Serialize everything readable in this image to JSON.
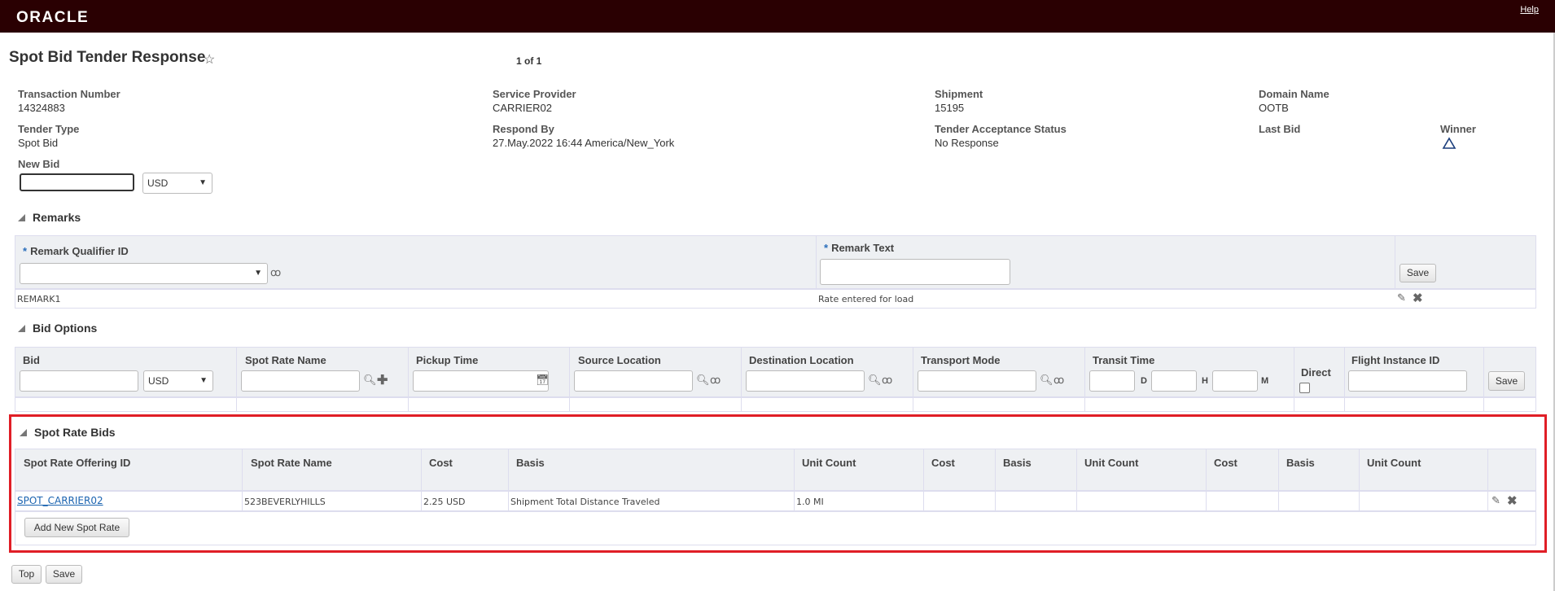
{
  "header": {
    "logo": "ORACLE",
    "help": "Help"
  },
  "page": {
    "title": "Spot Bid Tender Response",
    "pager": "1 of 1"
  },
  "fields": {
    "transaction_number": {
      "label": "Transaction Number",
      "value": "14324883"
    },
    "service_provider": {
      "label": "Service Provider",
      "value": "CARRIER02"
    },
    "shipment": {
      "label": "Shipment",
      "value": "15195"
    },
    "domain_name": {
      "label": "Domain Name",
      "value": "OOTB"
    },
    "tender_type": {
      "label": "Tender Type",
      "value": "Spot Bid"
    },
    "respond_by": {
      "label": "Respond By",
      "value": "27.May.2022 16:44 America/New_York"
    },
    "tender_acceptance_status": {
      "label": "Tender Acceptance Status",
      "value": "No Response"
    },
    "last_bid": {
      "label": "Last Bid"
    },
    "winner": {
      "label": "Winner",
      "icon": "warning-triangle-icon"
    },
    "new_bid": {
      "label": "New Bid",
      "value": "",
      "currency": "USD"
    }
  },
  "remarks": {
    "title": "Remarks",
    "col_qualifier": "Remark Qualifier ID",
    "col_text": "Remark Text",
    "required_mark": "*",
    "qualifier_value": "",
    "text_value": "",
    "save": "Save",
    "rows": [
      {
        "qualifier": "REMARK1",
        "text": "Rate entered for load"
      }
    ]
  },
  "bid_options": {
    "title": "Bid Options",
    "columns": [
      "Bid",
      "Spot Rate Name",
      "Pickup Time",
      "Source Location",
      "Destination Location",
      "Transport Mode",
      "Transit Time",
      "Direct",
      "Flight Instance ID"
    ],
    "currency": "USD",
    "transit_units": [
      "D",
      "H",
      "M"
    ],
    "save": "Save"
  },
  "spot_rate_bids": {
    "title": "Spot Rate Bids",
    "columns": [
      "Spot Rate Offering ID",
      "Spot Rate Name",
      "Cost",
      "Basis",
      "Unit Count",
      "Cost",
      "Basis",
      "Unit Count",
      "Cost",
      "Basis",
      "Unit Count"
    ],
    "rows": [
      {
        "offering_id": "SPOT_CARRIER02",
        "name": "523BEVERLYHILLS",
        "cost": "2.25 USD",
        "basis": "Shipment Total Distance Traveled",
        "unit_count": "1.0 MI"
      }
    ],
    "add_button": "Add New Spot Rate"
  },
  "footer": {
    "top": "Top",
    "save": "Save"
  }
}
